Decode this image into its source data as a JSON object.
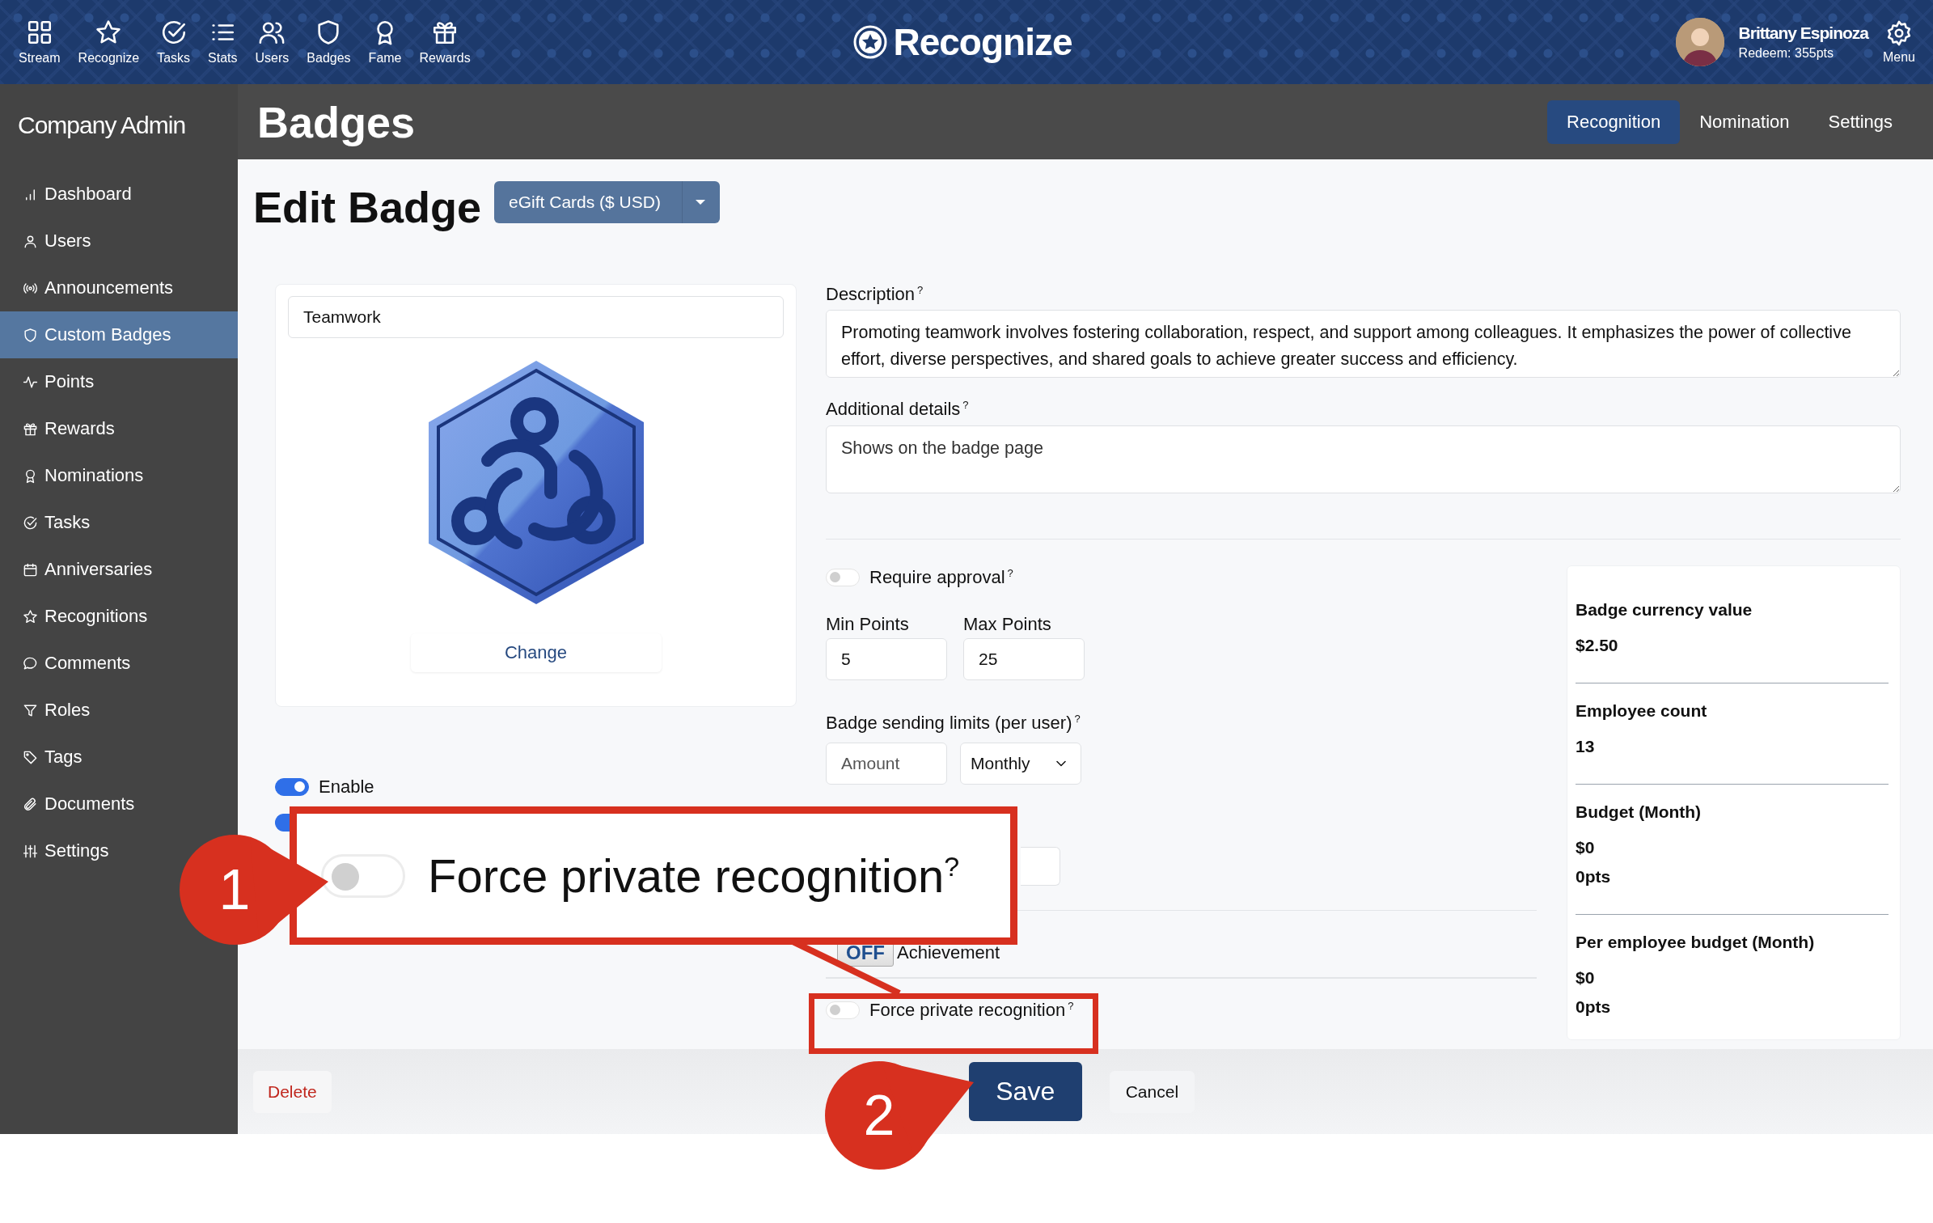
{
  "top_nav": {
    "items": [
      {
        "label": "Stream"
      },
      {
        "label": "Recognize"
      },
      {
        "label": "Tasks"
      },
      {
        "label": "Stats"
      },
      {
        "label": "Users"
      },
      {
        "label": "Badges"
      },
      {
        "label": "Fame"
      },
      {
        "label": "Rewards"
      }
    ],
    "logo": "Recognize",
    "user": {
      "name": "Brittany Espinoza",
      "redeem": "Redeem: 355pts"
    },
    "menu": "Menu"
  },
  "header": {
    "title": "Badges",
    "tabs": [
      {
        "label": "Recognition",
        "selected": true
      },
      {
        "label": "Nomination",
        "selected": false
      },
      {
        "label": "Settings",
        "selected": false
      }
    ]
  },
  "sidebar": {
    "title": "Company Admin",
    "items": [
      {
        "label": "Dashboard",
        "selected": false
      },
      {
        "label": "Users",
        "selected": false
      },
      {
        "label": "Announcements",
        "selected": false
      },
      {
        "label": "Custom Badges",
        "selected": true
      },
      {
        "label": "Points",
        "selected": false
      },
      {
        "label": "Rewards",
        "selected": false
      },
      {
        "label": "Nominations",
        "selected": false
      },
      {
        "label": "Tasks",
        "selected": false
      },
      {
        "label": "Anniversaries",
        "selected": false
      },
      {
        "label": "Recognitions",
        "selected": false
      },
      {
        "label": "Comments",
        "selected": false
      },
      {
        "label": "Roles",
        "selected": false
      },
      {
        "label": "Tags",
        "selected": false
      },
      {
        "label": "Documents",
        "selected": false
      },
      {
        "label": "Settings",
        "selected": false
      }
    ]
  },
  "form": {
    "title": "Edit Badge",
    "currency_button": "eGift Cards ($ USD)",
    "name": "Teamwork",
    "change": "Change",
    "toggles": [
      {
        "label": "Enable",
        "on": true
      },
      {
        "on": true
      }
    ],
    "description": {
      "label": "Description",
      "hint": "?",
      "value": "Promoting teamwork involves fostering collaboration, respect, and support among colleagues. It emphasizes the power of collective effort, diverse perspectives, and shared goals to achieve greater success and efficiency."
    },
    "additional": {
      "label": "Additional details",
      "hint": "?",
      "placeholder": "Shows on the badge page"
    },
    "require_approval": {
      "label": "Require approval",
      "hint": "?",
      "on": false
    },
    "min_points": {
      "label": "Min Points",
      "value": "5"
    },
    "max_points": {
      "label": "Max Points",
      "value": "25"
    },
    "sending_limits": {
      "label": "Badge sending limits (per user)",
      "hint": "?",
      "amount": {
        "placeholder": "Amount"
      },
      "period": "Monthly"
    },
    "achievement": {
      "switch": "OFF",
      "on": false,
      "label": "Achievement"
    },
    "force_private": {
      "label": "Force private recognition",
      "hint": "?",
      "on": false
    }
  },
  "stats": [
    {
      "label": "Badge currency value",
      "values": [
        "$2.50"
      ]
    },
    {
      "label": "Employee count",
      "values": [
        "13"
      ]
    },
    {
      "label": "Budget (Month)",
      "values": [
        "$0",
        "0pts"
      ]
    },
    {
      "label": "Per employee budget (Month)",
      "values": [
        "$0",
        "0pts"
      ]
    }
  ],
  "footer": {
    "delete": "Delete",
    "save": "Save",
    "cancel": "Cancel"
  },
  "annotations": {
    "callout": {
      "label": "Force private recognition",
      "hint": "?",
      "on": false
    },
    "markers": [
      "1",
      "2"
    ]
  }
}
